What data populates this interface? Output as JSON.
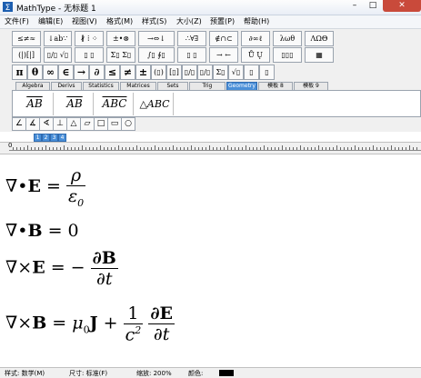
{
  "window": {
    "title": "MathType - 无标题 1",
    "minimize": "–",
    "maximize": "□",
    "close": "✕"
  },
  "menu": [
    "文件(F)",
    "编辑(E)",
    "视图(V)",
    "格式(M)",
    "样式(S)",
    "大小(Z)",
    "预置(P)",
    "帮助(H)"
  ],
  "toolbar_row1": [
    "≤≠≈",
    "↓ab∵",
    "∦ ⁞ ⁘",
    "±•⊗",
    "→⇔↓",
    "∴∀∃",
    "∉∩⊂",
    "∂∞ℓ",
    "λωθ",
    "ΛΩΘ"
  ],
  "toolbar_row2": [
    "(|)[|]",
    "▯/▯ √▯",
    "▯ ▯",
    "Σ▯ Σ▯",
    "∫▯ ∮▯",
    "▯ ▯",
    "→ ←",
    "Ů Ų",
    "▯▯▯",
    "▦"
  ],
  "toolbar_row3": [
    "π",
    "θ",
    "∞",
    "∈",
    "→",
    "∂",
    "≤",
    "≠",
    "±",
    "(▯)",
    "[▯]",
    "▯/▯",
    "▯/▯",
    "Σ▯",
    "√▯",
    "▯",
    "▯"
  ],
  "tabs": [
    "Algebra",
    "Derivs",
    "Statistics",
    "Matrices",
    "Sets",
    "Trig",
    "Geometry",
    "模板 8",
    "模板 9"
  ],
  "active_tab": "Geometry",
  "templates": [
    "AB",
    "AB",
    "ABC",
    "△ABC"
  ],
  "geometry_symbols": [
    "∠",
    "∡",
    "∢",
    "⊥",
    "△",
    "▱",
    "□",
    "▭",
    "○"
  ],
  "size_buttons": [
    "1",
    "2",
    "3",
    "4"
  ],
  "ruler": {
    "zero_label": "0"
  },
  "equations": {
    "eq1": {
      "lhs": "∇•",
      "field": "E",
      "rel": " = ",
      "num": "ρ",
      "den": "ε",
      "den_sub": "0"
    },
    "eq2": {
      "lhs": "∇•",
      "field": "B",
      "rel": " = 0"
    },
    "eq3": {
      "lhs": "∇×",
      "field": "E",
      "rel": " = −",
      "num": "∂B",
      "den": "∂t"
    },
    "eq4": {
      "lhs": "∇×",
      "field": "B",
      "rel": " = ",
      "mu": "μ",
      "mu_sub": "0",
      "J": "J",
      "plus": " + ",
      "num1": "1",
      "den1": "c",
      "den1_sup": "2",
      "num2": "∂E",
      "den2": "∂t"
    }
  },
  "status": {
    "style": "样式: 数学(M)",
    "size": "尺寸: 标准(F)",
    "zoom": "缩放: 200%",
    "color": "颜色:"
  }
}
